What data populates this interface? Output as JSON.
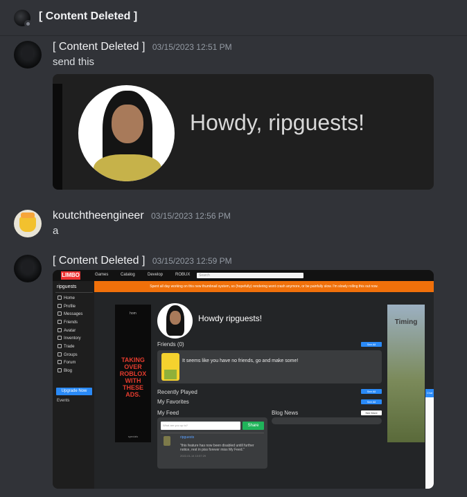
{
  "channel": {
    "title": "[ Content Deleted ]"
  },
  "messages": [
    {
      "author": "[ Content Deleted ]",
      "timestamp": "03/15/2023 12:51 PM",
      "text": "send this",
      "embed": {
        "greeting": "Howdy, ripguests!"
      }
    },
    {
      "author": "koutchtheengineer",
      "timestamp": "03/15/2023 12:56 PM",
      "text": "a"
    },
    {
      "author": "[ Content Deleted ]",
      "timestamp": "03/15/2023 12:59 PM",
      "screenshot": {
        "logo": "LIMBO",
        "nav": [
          "Games",
          "Catalog",
          "Develop",
          "ROBUX"
        ],
        "search_placeholder": "Search",
        "username": "ripguests",
        "sidebar": [
          "Home",
          "Profile",
          "Messages",
          "Friends",
          "Avatar",
          "Inventory",
          "Trade",
          "Groups",
          "Forum",
          "Blog"
        ],
        "upgrade_label": "Upgrade Now",
        "events_label": "Events",
        "banner": "Spent all day working on this new thumbnail system, so (hopefully) rendering wont crash anymore, or be painfully slow. I'm slowly rolling this out now.",
        "greeting": "Howdy ripguests!",
        "friends_label": "Friends (0)",
        "see_all": "See All",
        "no_friends": "It seems like you have no friends, go and make some!",
        "recently_played": "Recently Played",
        "my_favorites": "My Favorites",
        "my_feed": "My Feed",
        "blog_news": "Blog News",
        "see_more": "See More",
        "feed_placeholder": "What are you up to?",
        "share_label": "Share",
        "feed_post": {
          "name": "ripguests",
          "text": "\"this feature has now been disabled untill further notice, rest in piss forever miss My Feed.\"",
          "date": "2022-01-14 10:57:29"
        },
        "ad_left": {
          "top": "hom",
          "text": "TAKING OVER ROBLOX WITH THESE ADS.",
          "bottom": "specials"
        },
        "ad_right": {
          "text": "Timing"
        },
        "chat_tab": "Chat"
      }
    }
  ],
  "colors": {
    "bg": "#313338",
    "orange_banner": "#f0700a",
    "blue_button": "#2a8af7",
    "share_green": "#20b35a"
  }
}
